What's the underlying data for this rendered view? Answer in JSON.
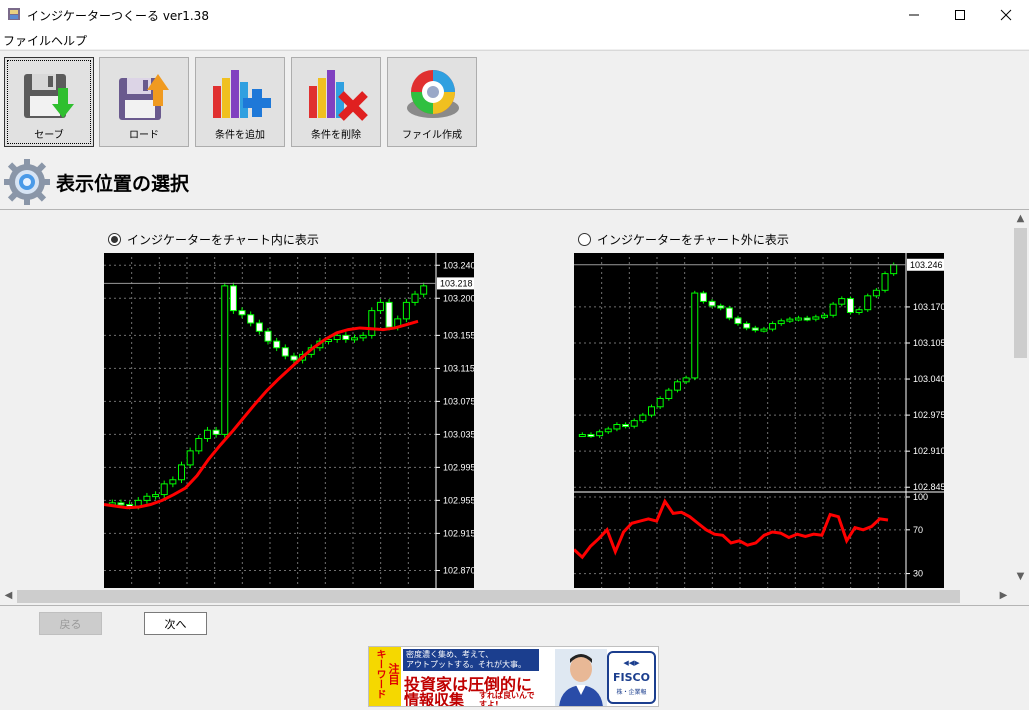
{
  "window": {
    "title": "インジケーターつくーる ver1.38",
    "minimize": "—",
    "maximize": "☐",
    "close": "✕"
  },
  "menu": [
    {
      "label": "ファイル"
    },
    {
      "label": "ヘルプ"
    }
  ],
  "toolbar": {
    "buttons": [
      {
        "label": "セーブ",
        "icon": "save-floppy-icon"
      },
      {
        "label": "ロード",
        "icon": "load-floppy-icon"
      },
      {
        "label": "条件を追加",
        "icon": "add-condition-icon"
      },
      {
        "label": "条件を削除",
        "icon": "delete-condition-icon"
      },
      {
        "label": "ファイル作成",
        "icon": "create-file-icon"
      }
    ]
  },
  "section": {
    "title": "表示位置の選択",
    "icon": "gear-icon"
  },
  "options": [
    {
      "label": "インジケーターをチャート内に表示",
      "selected": true
    },
    {
      "label": "インジケーターをチャート外に表示",
      "selected": false
    }
  ],
  "chart_data": [
    {
      "type": "candlestick",
      "title": "",
      "current_price": "103.218",
      "y_ticks": [
        "103.240",
        "103.200",
        "103.155",
        "103.115",
        "103.075",
        "103.035",
        "102.995",
        "102.955",
        "102.915",
        "102.870"
      ],
      "ylim": [
        102.85,
        103.25
      ],
      "series": [
        {
          "kind": "candles",
          "color": "#00ff00",
          "values": [
            102.952,
            102.95,
            102.948,
            102.955,
            102.96,
            102.962,
            102.975,
            102.98,
            102.998,
            103.015,
            103.03,
            103.04,
            103.035,
            103.215,
            103.185,
            103.18,
            103.17,
            103.16,
            103.148,
            103.14,
            103.13,
            103.125,
            103.132,
            103.14,
            103.148,
            103.15,
            103.155,
            103.15,
            103.152,
            103.155,
            103.185,
            103.195,
            103.165,
            103.175,
            103.195,
            103.205,
            103.215
          ]
        },
        {
          "kind": "line",
          "color": "#ff0000",
          "values": [
            102.95,
            102.948,
            102.946,
            102.947,
            102.95,
            102.955,
            102.962,
            102.97,
            102.985,
            103.005,
            103.022,
            103.038,
            103.055,
            103.072,
            103.088,
            103.102,
            103.115,
            103.128,
            103.14,
            103.15,
            103.158,
            103.162,
            103.164,
            103.163,
            103.162,
            103.164,
            103.168,
            103.172
          ]
        }
      ]
    },
    {
      "type": "candlestick",
      "title": "",
      "current_price": "103.246",
      "y_ticks": [
        "103.170",
        "103.105",
        "103.040",
        "102.975",
        "102.910",
        "102.845"
      ],
      "ylim": [
        102.84,
        103.26
      ],
      "series": [
        {
          "kind": "candles",
          "color": "#00ff00",
          "values": [
            102.94,
            102.938,
            102.945,
            102.95,
            102.958,
            102.955,
            102.965,
            102.975,
            102.99,
            103.005,
            103.02,
            103.035,
            103.042,
            103.195,
            103.18,
            103.172,
            103.168,
            103.15,
            103.14,
            103.132,
            103.128,
            103.13,
            103.14,
            103.145,
            103.148,
            103.15,
            103.148,
            103.152,
            103.155,
            103.175,
            103.185,
            103.16,
            103.165,
            103.19,
            103.2,
            103.23,
            103.246
          ]
        }
      ],
      "sub_chart": {
        "type": "line",
        "y_ticks": [
          "100",
          "70",
          "30"
        ],
        "ylim": [
          15,
          100
        ],
        "color": "#ff0000",
        "values": [
          52,
          45,
          55,
          62,
          70,
          50,
          68,
          76,
          78,
          80,
          78,
          96,
          85,
          86,
          82,
          76,
          70,
          66,
          65,
          58,
          60,
          56,
          58,
          65,
          68,
          67,
          63,
          66,
          64,
          66,
          65,
          84,
          82,
          60,
          72,
          70,
          73,
          80,
          79
        ]
      }
    }
  ],
  "nav": {
    "back": "戻る",
    "next": "次へ"
  },
  "ad": {
    "keyword": "キーワード",
    "highlight": "注目",
    "line1": "密度濃く集め、考えて、",
    "line2": "アウトプットする。それが大事。",
    "headline1": "投資家は圧倒的に",
    "headline2": "情報収集",
    "tail": "すれば良いんですよ!",
    "brand": "FISCO",
    "brand_sub": "株・企業報"
  }
}
